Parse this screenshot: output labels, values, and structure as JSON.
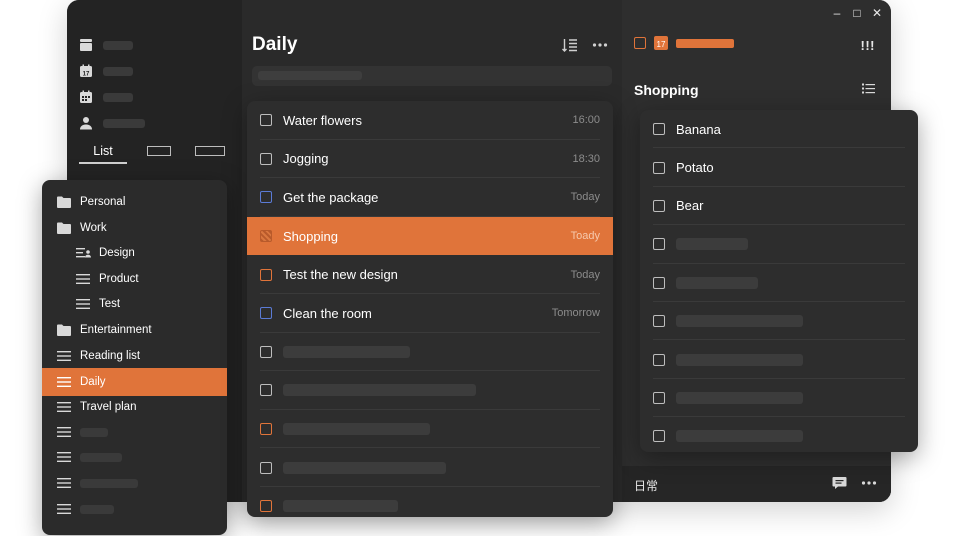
{
  "colors": {
    "accent": "#e0743a",
    "blue_checkbox": "#5b7bd6"
  },
  "window_controls": {
    "minimize": "–",
    "maximize": "□",
    "close": "✕"
  },
  "sidebar": {
    "nav_icons": [
      "inbox-icon",
      "today-calendar-icon",
      "week-calendar-icon",
      "user-icon"
    ],
    "today_number": "17",
    "tabs": {
      "list_label": "List"
    }
  },
  "lists": [
    {
      "label": "Personal",
      "icon": "folder-icon"
    },
    {
      "label": "Work",
      "icon": "folder-icon"
    },
    {
      "label": "Design",
      "icon": "list-user-icon"
    },
    {
      "label": "Product",
      "icon": "list-icon"
    },
    {
      "label": "Test",
      "icon": "list-icon"
    },
    {
      "label": "Entertainment",
      "icon": "folder-icon"
    },
    {
      "label": "Reading list",
      "icon": "list-icon"
    },
    {
      "label": "Daily",
      "icon": "list-icon",
      "active": true
    },
    {
      "label": "Travel plan",
      "icon": "list-icon"
    }
  ],
  "main": {
    "title": "Daily",
    "tasks": [
      {
        "title": "Water flowers",
        "time": "16:00"
      },
      {
        "title": "Jogging",
        "time": "18:30"
      },
      {
        "title": "Get the package",
        "time": "Today"
      },
      {
        "title": "Shopping",
        "time": "Toady"
      },
      {
        "title": "Test the new design",
        "time": "Today"
      },
      {
        "title": "Clean the room",
        "time": "Tomorrow"
      }
    ]
  },
  "detail": {
    "date_number": "17",
    "priority_marks": "!!!",
    "title": "Shopping",
    "items": [
      "Banana",
      "Potato",
      "Bear"
    ],
    "footer_label": "日常"
  }
}
